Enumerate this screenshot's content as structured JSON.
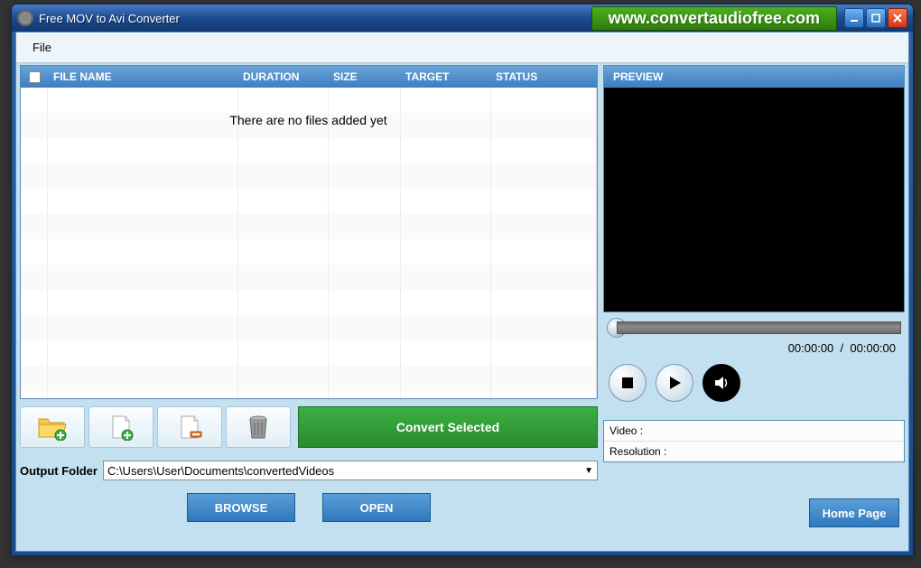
{
  "window": {
    "title": "Free MOV to Avi Converter",
    "url_banner": "www.convertaudiofree.com"
  },
  "menu": {
    "file": "File"
  },
  "file_table": {
    "columns": {
      "name": "FILE NAME",
      "duration": "DURATION",
      "size": "SIZE",
      "target": "TARGET",
      "status": "STATUS"
    },
    "empty_message": "There are no files added yet",
    "rows": []
  },
  "toolbar": {
    "add_folder": "add-folder",
    "add_file": "add-file",
    "remove": "remove",
    "clear_all": "clear-all",
    "convert_label": "Convert Selected"
  },
  "output": {
    "label": "Output Folder",
    "path": "C:\\Users\\User\\Documents\\convertedVideos"
  },
  "buttons": {
    "browse": "BROWSE",
    "open": "OPEN",
    "homepage": "Home Page"
  },
  "preview": {
    "header": "PREVIEW",
    "time_current": "00:00:00",
    "time_total": "00:00:00",
    "time_sep": "/",
    "video_label": "Video :",
    "video_value": "",
    "resolution_label": "Resolution :",
    "resolution_value": ""
  }
}
